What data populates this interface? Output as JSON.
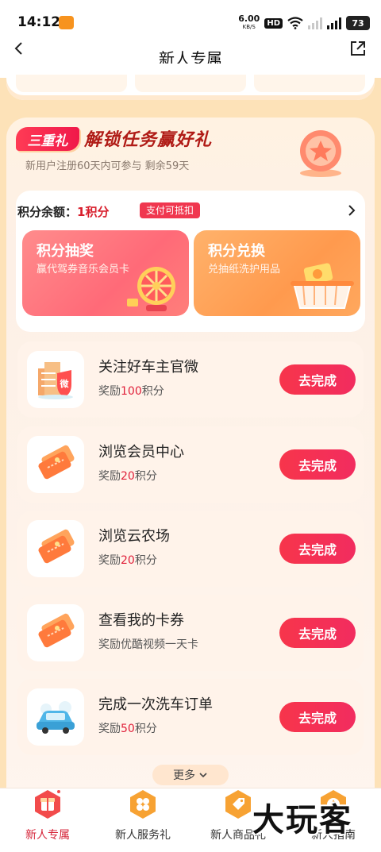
{
  "status_bar": {
    "time": "14:12",
    "net_speed": "6.00",
    "net_unit": "KB/S",
    "hd": "HD",
    "battery": "73"
  },
  "nav": {
    "title": "新人专属"
  },
  "section": {
    "badge": "三重礼",
    "title": "解锁任务赢好礼",
    "subtitle": "新用户注册60天内可参与 剩余59天"
  },
  "points": {
    "label": "积分余额：",
    "balance": "1积分",
    "tag": "支付可抵扣"
  },
  "tiles": [
    {
      "title": "积分抽奖",
      "subtitle": "赢代驾券音乐会员卡"
    },
    {
      "title": "积分兑换",
      "subtitle": "兑抽纸洗护用品"
    }
  ],
  "tasks": [
    {
      "name": "关注好车主官微",
      "reward_prefix": "奖励",
      "reward_value": "100",
      "reward_suffix": "积分",
      "button": "去完成",
      "icon": "weibo-building-icon"
    },
    {
      "name": "浏览会员中心",
      "reward_prefix": "奖励",
      "reward_value": "20",
      "reward_suffix": "积分",
      "button": "去完成",
      "icon": "coupon-ticket-icon"
    },
    {
      "name": "浏览云农场",
      "reward_prefix": "奖励",
      "reward_value": "20",
      "reward_suffix": "积分",
      "button": "去完成",
      "icon": "coupon-ticket-icon"
    },
    {
      "name": "查看我的卡券",
      "reward_prefix": "奖励优酷视频一天卡",
      "reward_value": "",
      "reward_suffix": "",
      "button": "去完成",
      "icon": "coupon-ticket-icon"
    },
    {
      "name": "完成一次洗车订单",
      "reward_prefix": "奖励",
      "reward_value": "50",
      "reward_suffix": "积分",
      "button": "去完成",
      "icon": "car-wash-icon"
    }
  ],
  "more": {
    "label": "更多"
  },
  "bottom_nav": [
    {
      "label": "新人专属",
      "active": true
    },
    {
      "label": "新人服务礼",
      "active": false
    },
    {
      "label": "新人商品礼",
      "active": false
    },
    {
      "label": "新人指南",
      "active": false
    }
  ],
  "watermark": "大玩客",
  "colors": {
    "accent": "#f0374f",
    "page_bg": "#fde2b8",
    "highlight": "#e0203a"
  }
}
